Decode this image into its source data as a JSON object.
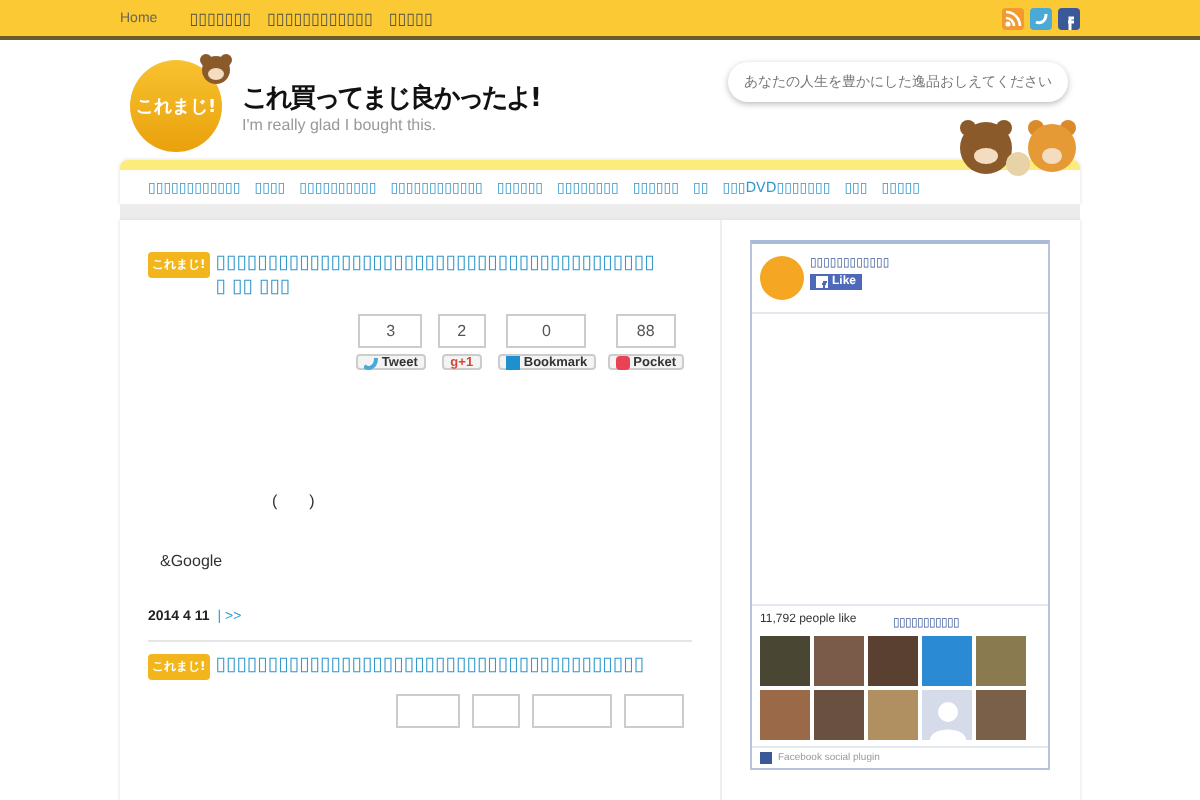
{
  "top_bar": {
    "links": [
      "Home",
      "▯▯▯▯▯▯▯",
      "▯▯▯▯▯▯▯▯▯▯▯▯",
      "▯▯▯▯▯"
    ]
  },
  "site": {
    "badge": "これまじ!",
    "title": "これ買ってまじ良かったよ!",
    "tagline": "I'm really glad I bought this.",
    "bubble": "あなたの人生を豊かにした逸品おしえてください"
  },
  "nav": [
    "▯▯▯▯▯▯▯▯▯▯▯▯",
    "▯▯▯▯",
    "▯▯▯▯▯▯▯▯▯▯",
    "▯▯▯▯▯▯▯▯▯▯▯▯",
    "▯▯▯▯▯▯",
    "▯▯▯▯▯▯▯▯",
    "▯▯▯▯▯▯",
    "▯▯",
    "▯▯▯DVD▯▯▯▯▯▯▯",
    "▯▯▯",
    "▯▯▯▯▯"
  ],
  "posts": [
    {
      "badge": "これまじ!",
      "title": "▯▯▯▯▯▯▯▯▯▯▯▯▯▯▯▯▯▯▯▯▯▯▯▯▯▯▯▯▯▯▯▯▯▯▯▯▯▯▯▯▯▯▯ ▯▯ ▯▯▯",
      "shares": [
        {
          "kind": "twitter",
          "count": "3",
          "label": "Tweet"
        },
        {
          "kind": "gplus",
          "count": "2",
          "label": "g+1"
        },
        {
          "kind": "hatena",
          "count": "0",
          "label": "Bookmark"
        },
        {
          "kind": "pocket",
          "count": "88",
          "label": "Pocket"
        }
      ],
      "body": [
        "(　　)",
        "&Google"
      ],
      "date": "2014  4  11",
      "more": "| >>"
    },
    {
      "badge": "これまじ!",
      "title": "▯▯▯▯▯▯▯▯▯▯▯▯▯▯▯▯▯▯▯▯▯▯▯▯▯▯▯▯▯▯▯▯▯▯▯▯▯▯▯▯▯",
      "shares": [
        {
          "kind": "twitter"
        },
        {
          "kind": "gplus"
        },
        {
          "kind": "hatena"
        },
        {
          "kind": "pocket"
        }
      ]
    }
  ],
  "facebook": {
    "page_name": "▯▯▯▯▯▯▯▯▯▯▯▯",
    "like": "Like",
    "people": "11,792 people like",
    "people_page": "▯▯▯▯▯▯▯▯▯▯▯",
    "faces": [
      {
        "kind": "photo"
      },
      {
        "kind": "photo"
      },
      {
        "kind": "photo"
      },
      {
        "kind": "photo"
      },
      {
        "kind": "photo"
      },
      {
        "kind": "photo"
      },
      {
        "kind": "photo"
      },
      {
        "kind": "photo"
      },
      {
        "kind": "silhouette"
      },
      {
        "kind": "photo"
      }
    ],
    "footer": "Facebook social plugin"
  }
}
